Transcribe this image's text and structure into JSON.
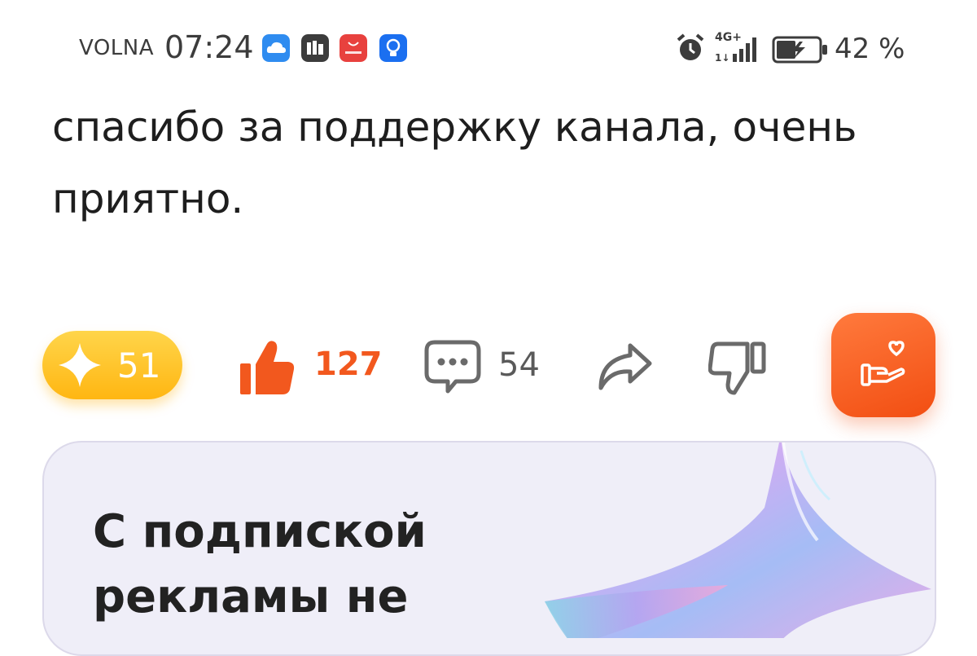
{
  "status_bar": {
    "carrier": "VOLNA",
    "time": "07:24",
    "network": "4G+",
    "battery_percent": "42 %",
    "notification_icons": [
      "cloud-icon",
      "mi-icon",
      "huawei-appgallery-icon",
      "tips-bulb-icon"
    ]
  },
  "comment": {
    "text": "спасибо за поддержку канала, очень приятно."
  },
  "actions": {
    "stars_count": "51",
    "likes_count": "127",
    "comments_count": "54"
  },
  "promo": {
    "title": "С подпиской рекламы не"
  },
  "colors": {
    "accent_orange": "#f2581e",
    "stars_yellow": "#ffc21f",
    "promo_bg": "#efeef8"
  }
}
